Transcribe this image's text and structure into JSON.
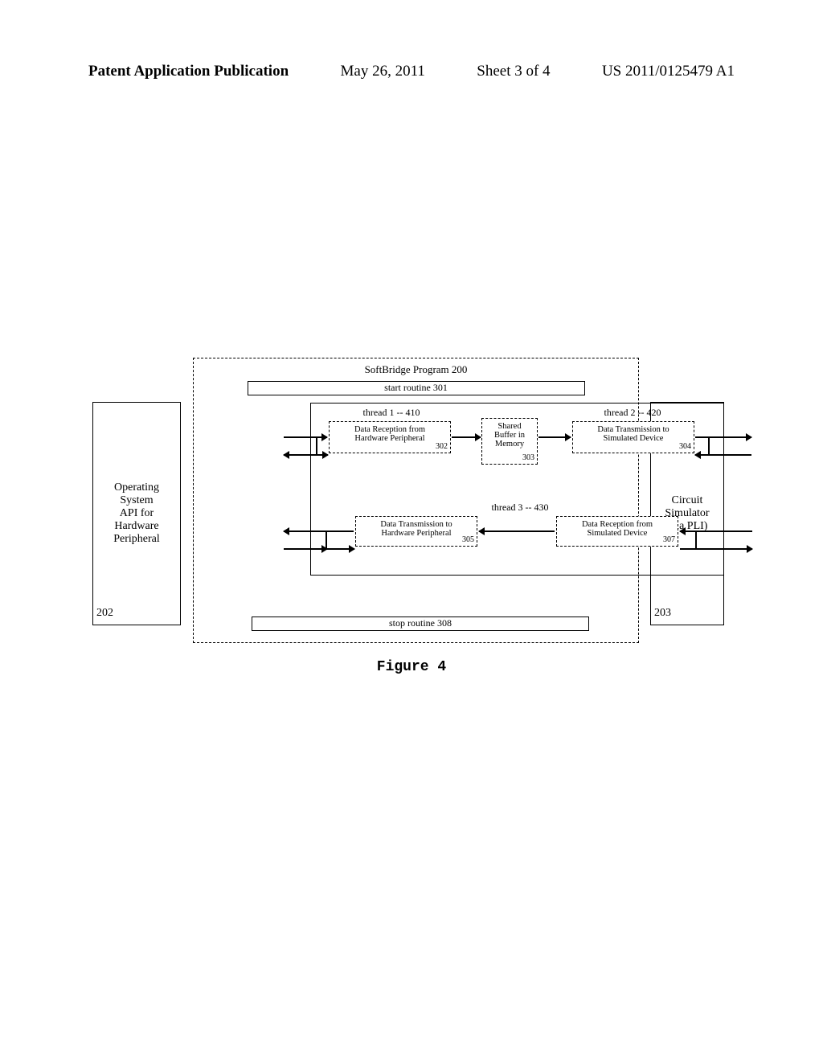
{
  "header": {
    "publication": "Patent Application Publication",
    "date": "May 26, 2011",
    "sheet": "Sheet 3 of 4",
    "docnumber": "US 2011/0125479 A1"
  },
  "left_box": {
    "lines": "Operating\nSystem\nAPI for\nHardware\nPeripheral",
    "num": "202"
  },
  "right_box": {
    "lines": "Circuit\nSimulator\n(via PLI)",
    "num": "203"
  },
  "softbridge": {
    "title": "SoftBridge Program 200",
    "start": "start routine 301",
    "stop": "stop routine 308"
  },
  "threads": {
    "t1_label": "thread 1 -- 410",
    "t2_label": "thread 2 -- 420",
    "t3_label": "thread 3 -- 430"
  },
  "blocks": {
    "b302": {
      "text": "Data Reception from\nHardware Peripheral",
      "num": "302"
    },
    "b303": {
      "text": "Shared\nBuffer in\nMemory",
      "num": "303"
    },
    "b304": {
      "text": "Data Transmission to\nSimulated Device",
      "num": "304"
    },
    "b305": {
      "text": "Data Transmission to\nHardware Peripheral",
      "num": "305"
    },
    "b307": {
      "text": "Data Reception from\nSimulated Device",
      "num": "307"
    }
  },
  "caption": "Figure 4"
}
